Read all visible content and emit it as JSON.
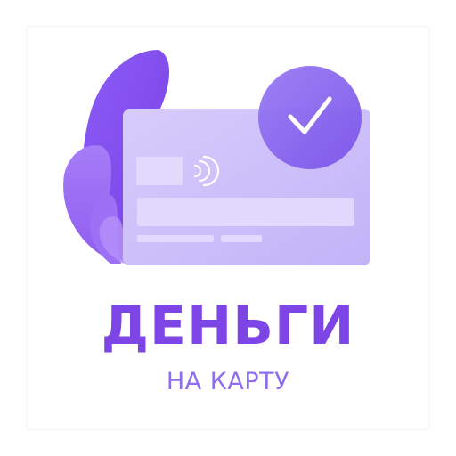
{
  "logo": {
    "title": "ДЕНЬГИ",
    "subtitle": "НА КАРТУ"
  },
  "icons": {
    "leaves": "leaf-shapes-icon",
    "card": "credit-card-icon",
    "contactless": "contactless-payment-icon",
    "check": "checkmark-badge-icon"
  },
  "colors": {
    "brand": "#7d45e6",
    "subtitle": "#8f6dee",
    "card": "#cfc3fb",
    "badge": "#8b67f0"
  }
}
